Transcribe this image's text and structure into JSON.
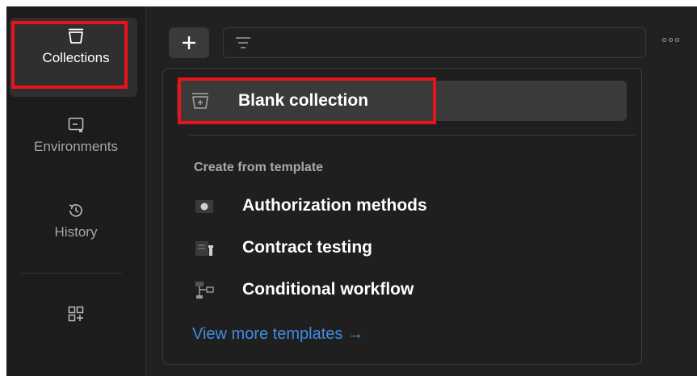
{
  "sidebar": {
    "items": [
      {
        "label": "Collections",
        "icon": "collections-icon",
        "active": true
      },
      {
        "label": "Environments",
        "icon": "environments-icon"
      },
      {
        "label": "History",
        "icon": "history-icon"
      }
    ],
    "extra_icon": "add-workspace-apps-icon"
  },
  "toolbar": {
    "new_icon": "plus-icon",
    "filter_icon": "filter-icon",
    "more_icon": "more-options-icon"
  },
  "dropdown": {
    "blank_collection_label": "Blank collection",
    "section_title": "Create from template",
    "templates": [
      {
        "label": "Authorization methods",
        "icon": "authorization-icon"
      },
      {
        "label": "Contract testing",
        "icon": "contract-testing-icon"
      },
      {
        "label": "Conditional workflow",
        "icon": "conditional-workflow-icon"
      }
    ],
    "view_more_label": "View more templates →"
  },
  "colors": {
    "highlight_box": "#e8131b",
    "link": "#3f8de6",
    "background": "#212121"
  }
}
